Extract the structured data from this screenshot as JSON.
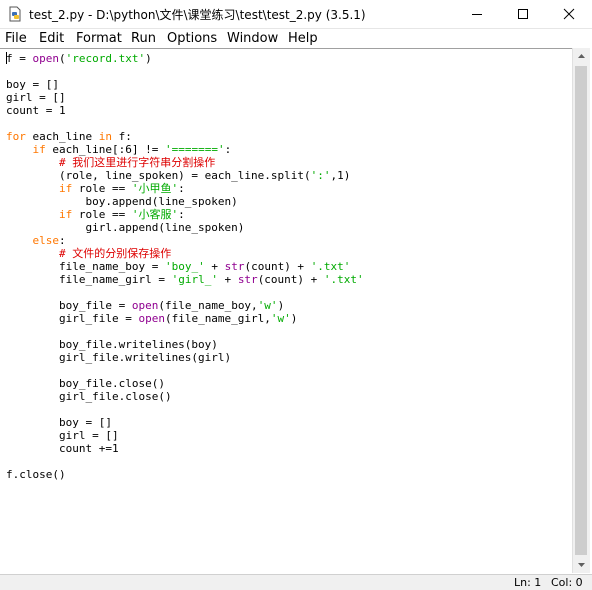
{
  "window": {
    "title": "test_2.py - D:\\python\\文件\\课堂练习\\test\\test_2.py (3.5.1)",
    "icons": [
      "python-file-icon",
      "minimize-icon",
      "maximize-icon",
      "close-icon"
    ]
  },
  "menu": {
    "items": [
      "File",
      "Edit",
      "Format",
      "Run",
      "Options",
      "Window",
      "Help"
    ]
  },
  "editor": {
    "lines": [
      [
        [
          "f = ",
          ""
        ],
        [
          "open",
          "bi"
        ],
        [
          "(",
          ""
        ],
        [
          "'record.txt'",
          "st"
        ],
        [
          ")",
          ""
        ]
      ],
      [],
      [
        [
          "boy = []",
          ""
        ]
      ],
      [
        [
          "girl = []",
          ""
        ]
      ],
      [
        [
          "count = 1",
          ""
        ]
      ],
      [],
      [
        [
          "for",
          "kw"
        ],
        [
          " each_line ",
          ""
        ],
        [
          "in",
          "kw"
        ],
        [
          " f:",
          ""
        ]
      ],
      [
        [
          "    ",
          ""
        ],
        [
          "if",
          "kw"
        ],
        [
          " each_line[:6] != ",
          ""
        ],
        [
          "'======='",
          "st"
        ],
        [
          ":",
          ""
        ]
      ],
      [
        [
          "        ",
          ""
        ],
        [
          "# 我们这里进行字符串分割操作",
          "cm"
        ]
      ],
      [
        [
          "        (role, line_spoken) = each_line.split(",
          ""
        ],
        [
          "':'",
          "st"
        ],
        [
          ",1)",
          ""
        ]
      ],
      [
        [
          "        ",
          ""
        ],
        [
          "if",
          "kw"
        ],
        [
          " role == ",
          ""
        ],
        [
          "'小甲鱼'",
          "st"
        ],
        [
          ":",
          ""
        ]
      ],
      [
        [
          "            boy.append(line_spoken)",
          ""
        ]
      ],
      [
        [
          "        ",
          ""
        ],
        [
          "if",
          "kw"
        ],
        [
          " role == ",
          ""
        ],
        [
          "'小客服'",
          "st"
        ],
        [
          ":",
          ""
        ]
      ],
      [
        [
          "            girl.append(line_spoken)",
          ""
        ]
      ],
      [
        [
          "    ",
          ""
        ],
        [
          "else",
          "kw"
        ],
        [
          ":",
          ""
        ]
      ],
      [
        [
          "        ",
          ""
        ],
        [
          "# 文件的分别保存操作",
          "cm"
        ]
      ],
      [
        [
          "        file_name_boy = ",
          ""
        ],
        [
          "'boy_'",
          "st"
        ],
        [
          " + ",
          ""
        ],
        [
          "str",
          "bi"
        ],
        [
          "(count) + ",
          ""
        ],
        [
          "'.txt'",
          "st"
        ]
      ],
      [
        [
          "        file_name_girl = ",
          ""
        ],
        [
          "'girl_'",
          "st"
        ],
        [
          " + ",
          ""
        ],
        [
          "str",
          "bi"
        ],
        [
          "(count) + ",
          ""
        ],
        [
          "'.txt'",
          "st"
        ]
      ],
      [],
      [
        [
          "        boy_file = ",
          ""
        ],
        [
          "open",
          "bi"
        ],
        [
          "(file_name_boy,",
          ""
        ],
        [
          "'w'",
          "st"
        ],
        [
          ")",
          ""
        ]
      ],
      [
        [
          "        girl_file = ",
          ""
        ],
        [
          "open",
          "bi"
        ],
        [
          "(file_name_girl,",
          ""
        ],
        [
          "'w'",
          "st"
        ],
        [
          ")",
          ""
        ]
      ],
      [],
      [
        [
          "        boy_file.writelines(boy)",
          ""
        ]
      ],
      [
        [
          "        girl_file.writelines(girl)",
          ""
        ]
      ],
      [],
      [
        [
          "        boy_file.close()",
          ""
        ]
      ],
      [
        [
          "        girl_file.close()",
          ""
        ]
      ],
      [],
      [
        [
          "        boy = []",
          ""
        ]
      ],
      [
        [
          "        girl = []",
          ""
        ]
      ],
      [
        [
          "        count +=1",
          ""
        ]
      ],
      [],
      [
        [
          "f.close()",
          ""
        ]
      ]
    ]
  },
  "status": {
    "line": "Ln: 1",
    "col": "Col: 0"
  }
}
